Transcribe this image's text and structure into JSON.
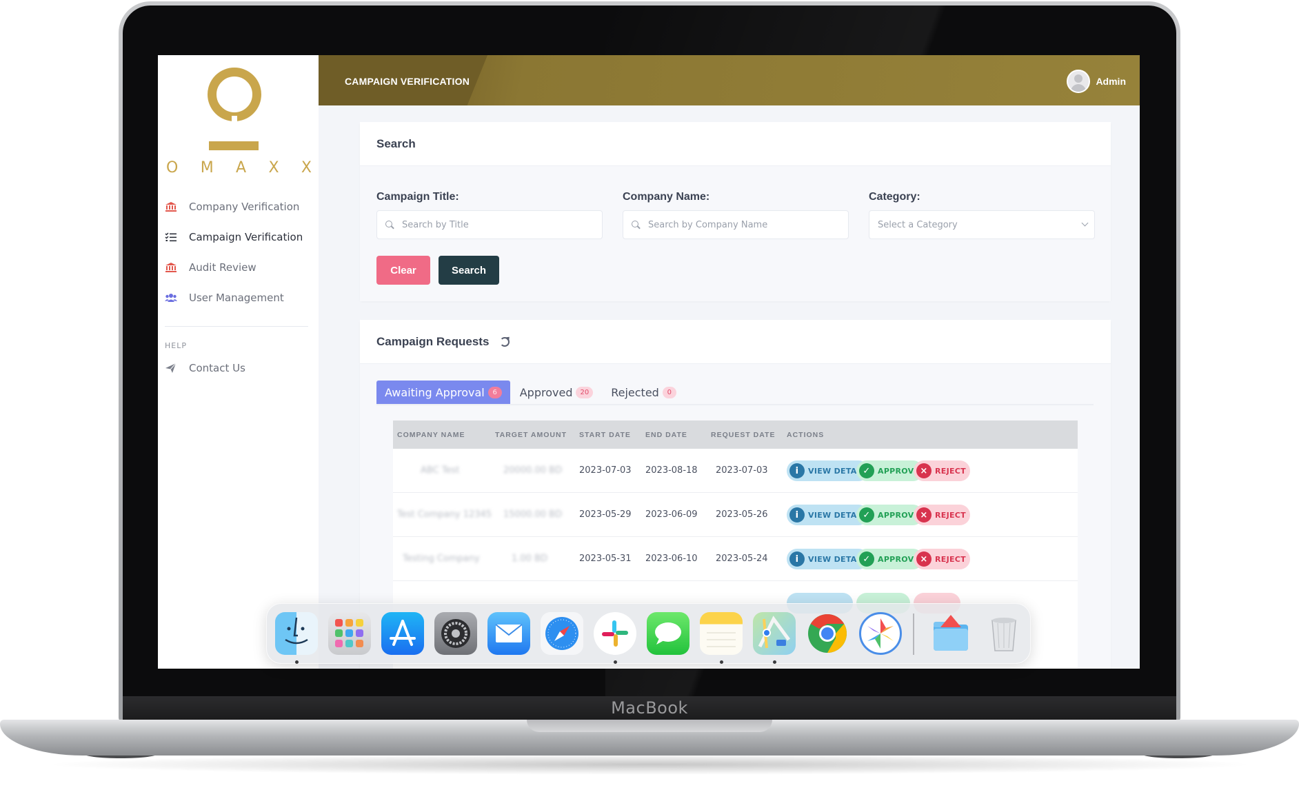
{
  "device": {
    "brand_label": "MacBook"
  },
  "sidebar": {
    "logo_letters": [
      "O",
      "M",
      "A",
      "X",
      "X"
    ],
    "items": [
      {
        "label": "Company Verification",
        "icon": "bank-icon"
      },
      {
        "label": "Campaign Verification",
        "icon": "list-check-icon",
        "active": true
      },
      {
        "label": "Audit Review",
        "icon": "bank-icon"
      },
      {
        "label": "User Management",
        "icon": "users-icon"
      }
    ],
    "help_heading": "HELP",
    "help_items": [
      {
        "label": "Contact Us",
        "icon": "paper-plane-icon"
      }
    ]
  },
  "header": {
    "title": "CAMPAIGN VERIFICATION",
    "user_name": "Admin"
  },
  "search": {
    "title": "Search",
    "campaign_title_label": "Campaign Title:",
    "campaign_title_placeholder": "Search by Title",
    "company_name_label": "Company Name:",
    "company_name_placeholder": "Search by Company Name",
    "category_label": "Category:",
    "category_selected": "Select a Category",
    "clear_label": "Clear",
    "search_label": "Search"
  },
  "requests": {
    "title": "Campaign Requests",
    "tabs": [
      {
        "label": "Awaiting Approval",
        "count": "6",
        "active": true
      },
      {
        "label": "Approved",
        "count": "20"
      },
      {
        "label": "Rejected",
        "count": "0"
      }
    ],
    "columns": [
      "COMPANY NAME",
      "TARGET AMOUNT",
      "START DATE",
      "END DATE",
      "REQUEST DATE",
      "ACTIONS"
    ],
    "rows": [
      {
        "company": "ABC Test",
        "target": "20000.00 BD",
        "start": "2023-07-03",
        "end": "2023-08-18",
        "request": "2023-07-03"
      },
      {
        "company": "Test Company 12345",
        "target": "15000.00 BD",
        "start": "2023-05-29",
        "end": "2023-06-09",
        "request": "2023-05-26"
      },
      {
        "company": "Testing Company",
        "target": "1.00 BD",
        "start": "2023-05-31",
        "end": "2023-06-10",
        "request": "2023-05-24"
      }
    ],
    "actions": {
      "view": "VIEW DETAIL",
      "approve": "APPROVE",
      "reject": "REJECT"
    }
  },
  "dock": {
    "apps": [
      "finder-icon",
      "launchpad-icon",
      "app-store-icon",
      "system-settings-icon",
      "mail-icon",
      "safari-icon",
      "slack-icon",
      "messages-icon",
      "notes-icon",
      "maps-icon",
      "chrome-icon",
      "photos-icon",
      "downloads-folder-icon",
      "trash-icon"
    ]
  },
  "colors": {
    "brand_gold": "#c9a64c",
    "header": "#7b672b",
    "tab_active": "#7a89ee",
    "clear_button": "#f06b86",
    "search_button": "#233d45"
  }
}
